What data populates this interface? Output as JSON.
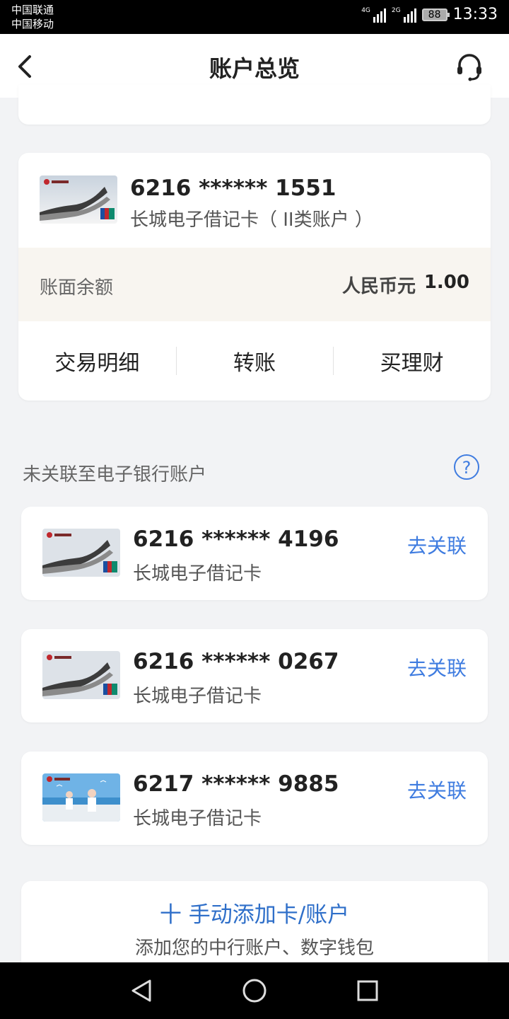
{
  "status_bar": {
    "carrier_1": "中国联通",
    "carrier_2": "中国移动",
    "signal_1": "4G",
    "signal_2": "2G",
    "battery": "88",
    "time": "13:33"
  },
  "nav": {
    "title": "账户总览",
    "back_icon": "chevron-left-icon",
    "support_icon": "headset-icon"
  },
  "primary_account": {
    "number": "6216 ****** 1551",
    "type": "长城电子借记卡（ II类账户 ）",
    "balance_label": "账面余额",
    "currency": "人民币元",
    "balance": "1.00",
    "actions": [
      "交易明细",
      "转账",
      "买理财"
    ]
  },
  "unlinked_section": {
    "title": "未关联至电子银行账户",
    "help_icon": "question-circle-icon",
    "help_symbol": "?",
    "link_label": "去关联",
    "items": [
      {
        "number": "6216 ****** 4196",
        "type": "长城电子借记卡"
      },
      {
        "number": "6216 ****** 0267",
        "type": "长城电子借记卡"
      },
      {
        "number": "6217 ****** 9885",
        "type": "长城电子借记卡"
      }
    ]
  },
  "add_account": {
    "title": "十 手动添加卡/账户",
    "subtitle": "添加您的中行账户、数字钱包"
  },
  "colors": {
    "accent": "#3f7ce0",
    "page_bg": "#f2f3f5",
    "balance_bg": "#f8f5f0"
  }
}
